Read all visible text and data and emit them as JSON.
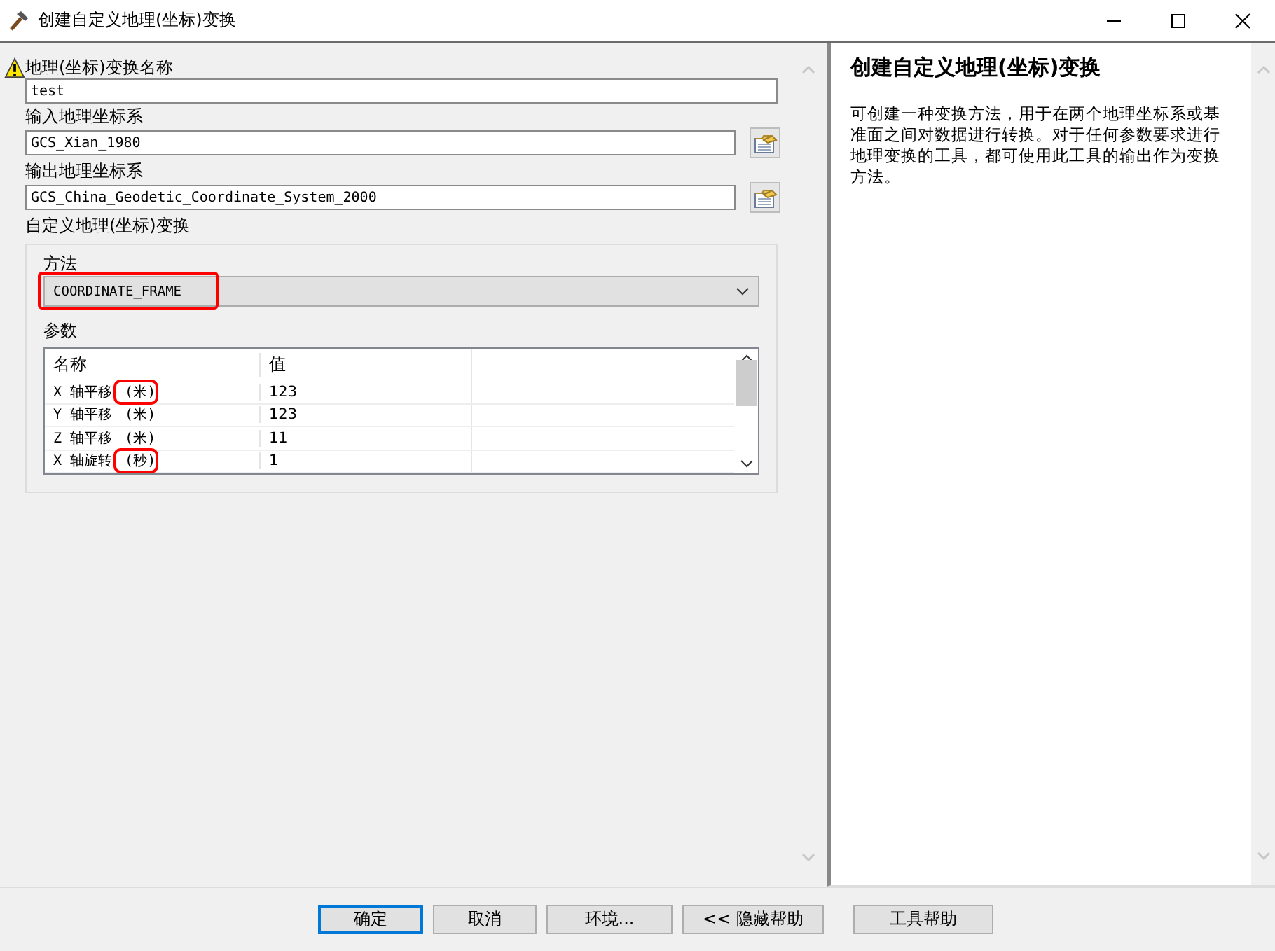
{
  "window": {
    "title": "创建自定义地理(坐标)变换"
  },
  "form": {
    "fields": [
      {
        "kind": "text",
        "label": "地理(坐标)变换名称",
        "value": "test",
        "warning": true
      },
      {
        "kind": "browse",
        "label": "输入地理坐标系",
        "value": "GCS_Xian_1980",
        "warning": false
      },
      {
        "kind": "browse",
        "label": "输出地理坐标系",
        "value": "GCS_China_Geodetic_Coordinate_System_2000",
        "warning": false
      }
    ],
    "group": {
      "label": "自定义地理(坐标)变换",
      "method_label": "方法",
      "method": {
        "value": "COORDINATE_FRAME",
        "highlighted": true
      },
      "params_label": "参数",
      "columns": [
        "名称",
        "值"
      ],
      "rows": [
        {
          "name": "X 轴平移",
          "unit": "(米)",
          "unit_highlighted": true,
          "value": "123"
        },
        {
          "name": "Y 轴平移",
          "unit": "(米)",
          "unit_highlighted": false,
          "value": "123"
        },
        {
          "name": "Z 轴平移",
          "unit": "(米)",
          "unit_highlighted": false,
          "value": "11"
        },
        {
          "name": "X 轴旋转",
          "unit": "(秒)",
          "unit_highlighted": true,
          "value": "1"
        }
      ]
    }
  },
  "help": {
    "title": "创建自定义地理(坐标)变换",
    "text": "可创建一种变换方法，用于在两个地理坐标系或基准面之间对数据进行转换。对于任何参数要求进行地理变换的工具，都可使用此工具的输出作为变换方法。"
  },
  "buttons": [
    {
      "label": "确定",
      "focused": true
    },
    {
      "label": "取消",
      "focused": false
    },
    {
      "label": "环境...",
      "focused": false
    },
    {
      "label": "<< 隐藏帮助",
      "focused": false
    },
    {
      "label": "工具帮助",
      "focused": false
    }
  ]
}
